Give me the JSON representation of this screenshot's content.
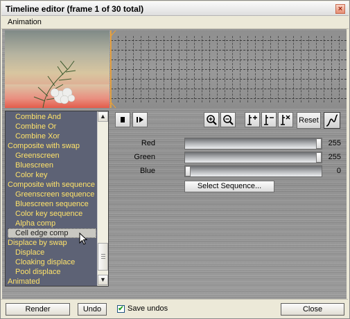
{
  "window": {
    "title": "Timeline editor  (frame 1 of  30 total)",
    "close_glyph": "×"
  },
  "menu": {
    "items": [
      "Animation"
    ]
  },
  "effects_list": {
    "items": [
      {
        "label": "Combine And",
        "level": "sub"
      },
      {
        "label": "Combine Or",
        "level": "sub"
      },
      {
        "label": "Combine Xor",
        "level": "sub"
      },
      {
        "label": "Composite with swap",
        "level": "top"
      },
      {
        "label": "Greenscreen",
        "level": "sub"
      },
      {
        "label": "Bluescreen",
        "level": "sub"
      },
      {
        "label": "Color key",
        "level": "sub"
      },
      {
        "label": "Composite with sequence",
        "level": "top"
      },
      {
        "label": "Greenscreen sequence",
        "level": "sub"
      },
      {
        "label": "Bluescreen sequence",
        "level": "sub"
      },
      {
        "label": "Color key sequence",
        "level": "sub"
      },
      {
        "label": "Alpha comp",
        "level": "sub"
      },
      {
        "label": "Cell edge comp",
        "level": "sub",
        "selected": true
      },
      {
        "label": "Displace by swap",
        "level": "top"
      },
      {
        "label": "Displace",
        "level": "sub"
      },
      {
        "label": "Cloaking displace",
        "level": "sub"
      },
      {
        "label": "Pool displace",
        "level": "sub"
      },
      {
        "label": "Animated",
        "level": "top"
      }
    ],
    "scroll_up_glyph": "▲",
    "scroll_down_glyph": "▼",
    "item_color": "#ffe36a",
    "background_color": "#5d6275"
  },
  "toolbar": {
    "stop_icon": "stop-icon",
    "play_frame_icon": "step-forward-icon",
    "zoom_in_icon": "zoom-in-icon",
    "zoom_out_icon": "zoom-out-icon",
    "add_key_icon": "add-keyframe-icon",
    "remove_key_icon": "remove-keyframe-icon",
    "delete_key_icon": "delete-keyframe-icon",
    "reset_label": "Reset",
    "curve_icon": "curve-icon"
  },
  "sliders": [
    {
      "label": "Red",
      "value": "255",
      "fraction": 1.0
    },
    {
      "label": "Green",
      "value": "255",
      "fraction": 1.0
    },
    {
      "label": "Blue",
      "value": "0",
      "fraction": 0.0
    }
  ],
  "select_sequence_label": "Select Sequence...",
  "bottom": {
    "render_label": "Render",
    "undo_label": "Undo",
    "save_undos_label": "Save undos",
    "save_undos_checked": true,
    "close_label": "Close"
  }
}
